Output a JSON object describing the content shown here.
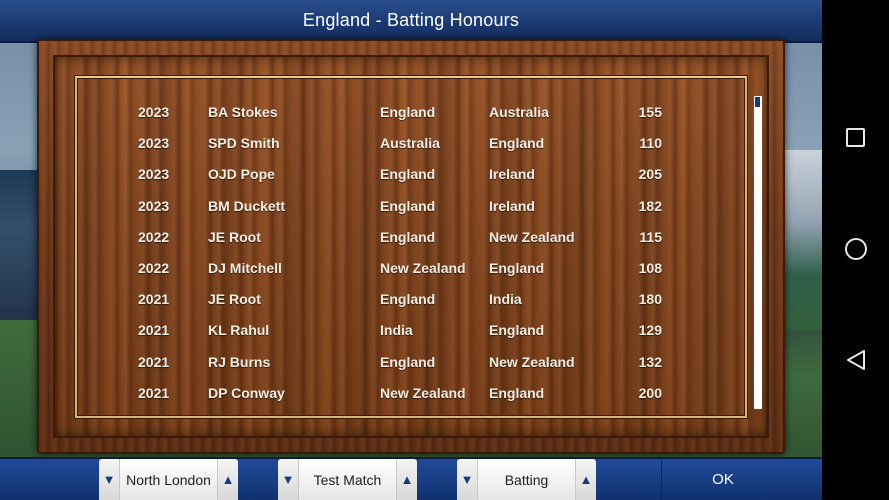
{
  "title": "England - Batting Honours",
  "rows": [
    {
      "year": "2023",
      "player": "BA Stokes",
      "team": "England",
      "opponent": "Australia",
      "score": "155"
    },
    {
      "year": "2023",
      "player": "SPD Smith",
      "team": "Australia",
      "opponent": "England",
      "score": "110"
    },
    {
      "year": "2023",
      "player": "OJD Pope",
      "team": "England",
      "opponent": "Ireland",
      "score": "205"
    },
    {
      "year": "2023",
      "player": "BM Duckett",
      "team": "England",
      "opponent": "Ireland",
      "score": "182"
    },
    {
      "year": "2022",
      "player": "JE Root",
      "team": "England",
      "opponent": "New Zealand",
      "score": "115"
    },
    {
      "year": "2022",
      "player": "DJ Mitchell",
      "team": "New Zealand",
      "opponent": "England",
      "score": "108"
    },
    {
      "year": "2021",
      "player": "JE Root",
      "team": "England",
      "opponent": "India",
      "score": "180"
    },
    {
      "year": "2021",
      "player": "KL Rahul",
      "team": "India",
      "opponent": "England",
      "score": "129"
    },
    {
      "year": "2021",
      "player": "RJ Burns",
      "team": "England",
      "opponent": "New Zealand",
      "score": "132"
    },
    {
      "year": "2021",
      "player": "DP Conway",
      "team": "New Zealand",
      "opponent": "England",
      "score": "200"
    }
  ],
  "scroll": {
    "position_fraction": 0.0
  },
  "bottom": {
    "venue": "North London",
    "format": "Test Match",
    "category": "Batting",
    "ok_label": "OK"
  },
  "icons": {
    "down": "▼",
    "up": "▲"
  },
  "colors": {
    "bar_blue": "#173b80",
    "wood": "#8a4a22",
    "gold": "#d6b676"
  }
}
